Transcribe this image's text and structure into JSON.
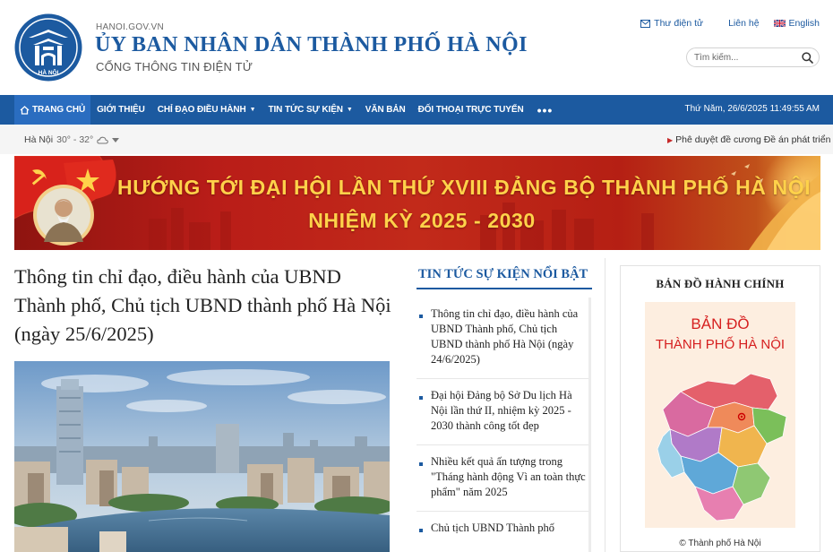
{
  "header": {
    "domain": "HANOI.GOV.VN",
    "title": "ỦY BAN NHÂN DÂN THÀNH PHỐ HÀ NỘI",
    "subtitle": "CỔNG THÔNG TIN ĐIỆN TỬ",
    "logo_text": "HÀ NỘI",
    "links": {
      "mail": "Thư điện tử",
      "contact": "Liên hệ",
      "language": "English"
    },
    "search_placeholder": "Tìm kiếm..."
  },
  "nav": {
    "items": [
      {
        "label": "TRANG CHỦ",
        "active": true,
        "icon": "home-icon"
      },
      {
        "label": "GIỚI THIỆU"
      },
      {
        "label": "CHỈ ĐẠO ĐIỀU HÀNH",
        "dropdown": true
      },
      {
        "label": "TIN TỨC SỰ KIỆN",
        "dropdown": true
      },
      {
        "label": "VĂN BẢN"
      },
      {
        "label": "ĐỐI THOẠI TRỰC TUYẾN"
      }
    ],
    "more": "•••",
    "datetime": "Thứ Năm, 26/6/2025 11:49:55 AM"
  },
  "subbar": {
    "city": "Hà Nội",
    "temperature": "30° - 32°",
    "weather_icon": "cloud-icon",
    "ticker": "Phê duyệt đề cương Đề án phát triển"
  },
  "banner": {
    "line1": "HƯỚNG TỚI ĐẠI HỘI LẦN THỨ XVIII ĐẢNG BỘ THÀNH PHỐ HÀ NỘI",
    "line2": "NHIỆM KỲ 2025 - 2030"
  },
  "main_article": {
    "title": "Thông tin chỉ đạo, điều hành của UBND Thành phố, Chủ tịch UBND thành phố Hà Nội (ngày 25/6/2025)"
  },
  "highlights": {
    "title": "TIN TỨC SỰ KIỆN NỔI BẬT",
    "items": [
      "Thông tin chỉ đạo, điều hành của UBND Thành phố, Chủ tịch UBND thành phố Hà Nội (ngày 24/6/2025)",
      "Đại hội Đảng bộ Sở Du lịch Hà Nội lần thứ II, nhiệm kỳ 2025 - 2030 thành công tốt đẹp",
      "Nhiều kết quả ấn tượng trong \"Tháng hành động Vì an toàn thực phẩm\" năm 2025",
      "Chủ tịch UBND Thành phố"
    ]
  },
  "map": {
    "title": "BẢN ĐỒ HÀNH CHÍNH",
    "heading_line1": "BẢN ĐỒ",
    "heading_line2": "THÀNH PHỐ HÀ NỘI",
    "caption": "© Thành phố Hà Nội"
  },
  "colors": {
    "brand_blue": "#1c5aa0",
    "banner_red": "#b91d18",
    "banner_gold": "#ffd24a"
  }
}
